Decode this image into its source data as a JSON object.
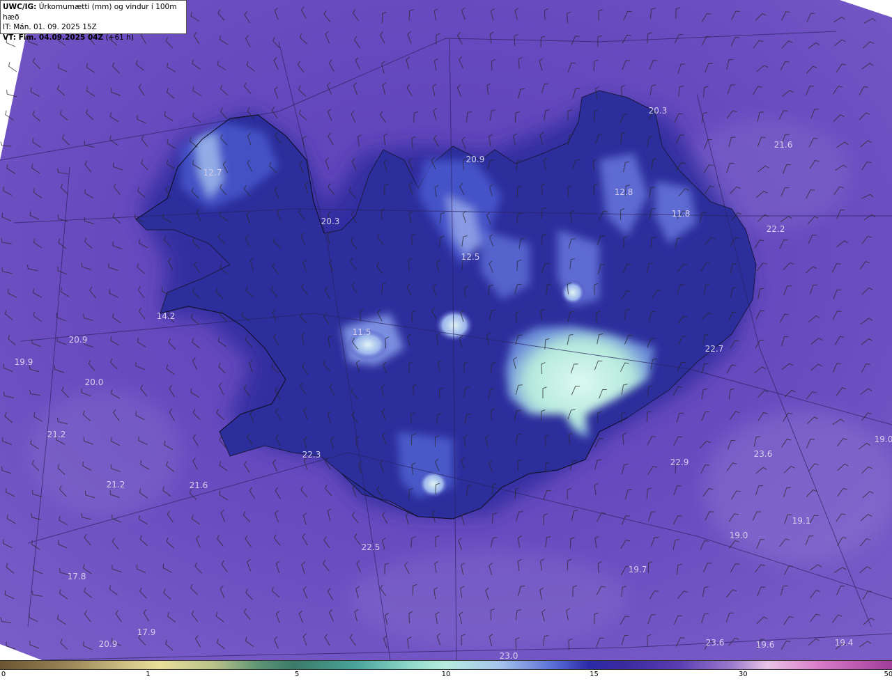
{
  "header": {
    "model": "UWC/IG:",
    "title": "Úrkomumætti (mm) og vindur í 100m hæð",
    "initial_time": "IT: Mán. 01. 09. 2025 15Z",
    "valid_label": "VT: Fim. 04.09.2025 04Z",
    "valid_offset": "(+61 h)"
  },
  "colorbar": {
    "ticks": [
      {
        "label": "0",
        "value": 0
      },
      {
        "label": "1",
        "value": 1
      },
      {
        "label": "5",
        "value": 5
      },
      {
        "label": "10",
        "value": 10
      },
      {
        "label": "15",
        "value": 15
      },
      {
        "label": "30",
        "value": 30
      },
      {
        "label": "50",
        "value": 50
      }
    ]
  },
  "map_values": [
    {
      "label": "20.3"
    },
    {
      "label": "21.6"
    },
    {
      "label": "20.9"
    },
    {
      "label": "12.7"
    },
    {
      "label": "12.8"
    },
    {
      "label": "11.8"
    },
    {
      "label": "20.3"
    },
    {
      "label": "22.2"
    },
    {
      "label": "12.5"
    },
    {
      "label": "14.2"
    },
    {
      "label": "11.5"
    },
    {
      "label": "20.9"
    },
    {
      "label": "19.9"
    },
    {
      "label": "20.0"
    },
    {
      "label": "22.7"
    },
    {
      "label": "21.2"
    },
    {
      "label": "19.0"
    },
    {
      "label": "22.3"
    },
    {
      "label": "23.6"
    },
    {
      "label": "22.9"
    },
    {
      "label": "21.2"
    },
    {
      "label": "21.6"
    },
    {
      "label": "19.1"
    },
    {
      "label": "19.0"
    },
    {
      "label": "22.5"
    },
    {
      "label": "19.7"
    },
    {
      "label": "17.8"
    },
    {
      "label": "17.9"
    },
    {
      "label": "20.9"
    },
    {
      "label": "23.6"
    },
    {
      "label": "19.6"
    },
    {
      "label": "19.4"
    },
    {
      "label": "23.0"
    }
  ],
  "colors": {
    "ocean": "#5b43b8",
    "land_low": "#2b2c9c",
    "glacier": "#c8f0e0"
  }
}
